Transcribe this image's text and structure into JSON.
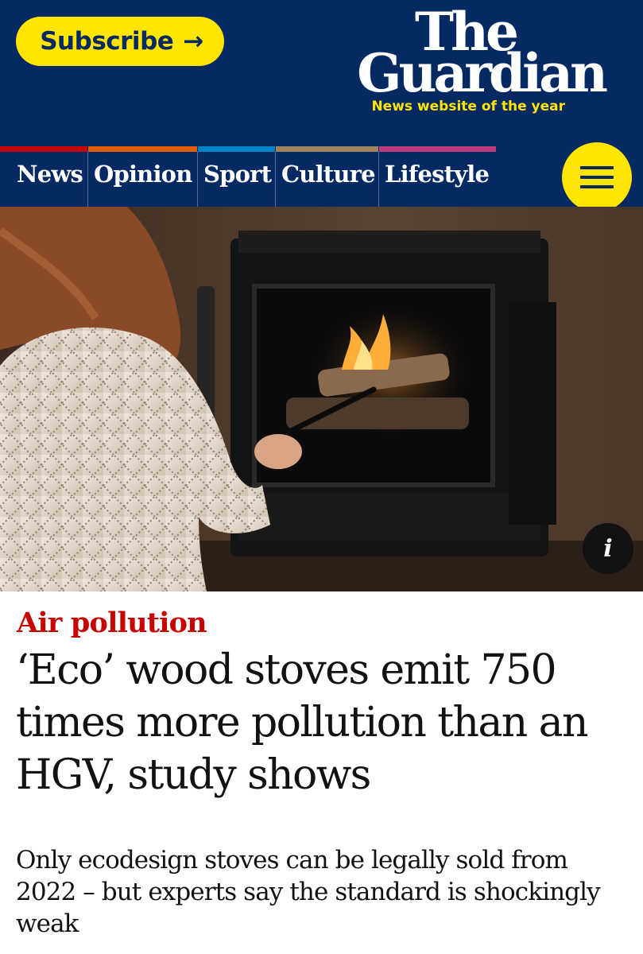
{
  "header": {
    "subscribe_label": "Subscribe",
    "subscribe_arrow": "→",
    "logo_line1": "The",
    "logo_line2": "Guardian",
    "tagline": "News website of the year"
  },
  "nav": {
    "items": [
      {
        "label": "News",
        "color": "#c70000"
      },
      {
        "label": "Opinion",
        "color": "#e05e00"
      },
      {
        "label": "Sport",
        "color": "#0084c6"
      },
      {
        "label": "Culture",
        "color": "#a1845c"
      },
      {
        "label": "Lifestyle",
        "color": "#bb3b80"
      }
    ],
    "menu_icon": "hamburger-menu-icon"
  },
  "hero": {
    "info_glyph": "i"
  },
  "article": {
    "kicker": "Air pollution",
    "headline_lines": [
      "‘Eco’ wood stoves emit 750",
      "times more pollution than an",
      "HGV, study shows"
    ],
    "standfirst_lines": [
      "Only ecodesign stoves can be legally sold from",
      "2022 – but experts say the standard is shockingly",
      "weak"
    ]
  },
  "colors": {
    "brand_blue": "#052962",
    "accent_yellow": "#ffe500",
    "kicker_red": "#c70000"
  }
}
